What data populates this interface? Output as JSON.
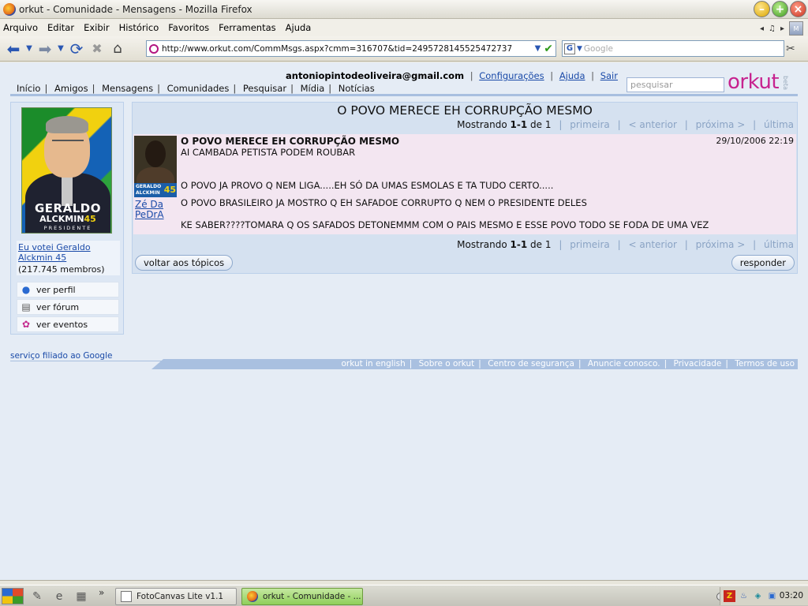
{
  "window": {
    "title": "orkut - Comunidade - Mensagens - Mozilla Firefox"
  },
  "menubar": {
    "items": [
      "Arquivo",
      "Editar",
      "Exibir",
      "Histórico",
      "Favoritos",
      "Ferramentas",
      "Ajuda"
    ]
  },
  "toolbar": {
    "url": "http://www.orkut.com/CommMsgs.aspx?cmm=316707&tid=2495728145525472737",
    "search_placeholder": "Google",
    "icons": [
      "back-icon",
      "dropdown-icon",
      "forward-icon",
      "dropdown-icon",
      "reload-icon",
      "stop-icon",
      "home-icon"
    ]
  },
  "orkut": {
    "user_email": "antoniopintodeoliveira@gmail.com",
    "user_links": [
      "Configurações",
      "Ajuda",
      "Sair"
    ],
    "nav": [
      "Início",
      "Amigos",
      "Mensagens",
      "Comunidades",
      "Pesquisar",
      "Mídia",
      "Notícias"
    ],
    "search_placeholder": "pesquisar",
    "logo": "orkut",
    "logo_beta": "beta"
  },
  "community": {
    "poster_name": "GERALDO",
    "poster_name2": "ALCKMIN",
    "poster_number": "45",
    "poster_sub": "PRESIDENTE",
    "link_line1": "Eu votei Geraldo",
    "link_line2": "Alckmin 45",
    "members": "(217.745 membros)",
    "actions": [
      {
        "label": "ver perfil",
        "icon": "person-icon"
      },
      {
        "label": "ver fórum",
        "icon": "forum-icon"
      },
      {
        "label": "ver eventos",
        "icon": "balloons-icon"
      }
    ]
  },
  "topic": {
    "title": "O POVO MERECE EH CORRUPÇÃO MESMO",
    "pager": {
      "prefix": "Mostrando",
      "range": "1-1",
      "of": "de",
      "total": "1",
      "first": "primeira",
      "prev": "< anterior",
      "next": "próxima >",
      "last": "última"
    },
    "post": {
      "author_line1": "Zé Da",
      "author_line2": "PeDrA",
      "avatar_badge": "GERALDO ALCKMIN",
      "avatar_number": "45",
      "title": "O POVO MERECE EH CORRUPÇÃO MESMO",
      "date": "29/10/2006 22:19",
      "lines": [
        "AI CAMBADA PETISTA PODEM ROUBAR",
        "O POVO JA PROVO Q NEM LIGA.....EH SÓ DA UMAS ESMOLAS E TA TUDO CERTO.....",
        "O POVO BRASILEIRO JA MOSTRO Q EH SAFADOE CORRUPTO Q NEM O PRESIDENTE DELES",
        "KE SABER????TOMARA Q OS SAFADOS DETONEMMM COM O PAIS MESMO E ESSE POVO TODO SE FODA DE UMA VEZ"
      ]
    },
    "back_button": "voltar aos tópicos",
    "reply_button": "responder"
  },
  "footer": {
    "left": "serviço filiado ao Google",
    "links": [
      "orkut in english",
      "Sobre o orkut",
      "Centro de segurança",
      "Anuncie conosco.",
      "Privacidade",
      "Termos de uso"
    ]
  },
  "taskbar": {
    "tasks": [
      "FotoCanvas Lite v1.1",
      "orkut - Comunidade - ..."
    ],
    "clock": "03:20"
  }
}
